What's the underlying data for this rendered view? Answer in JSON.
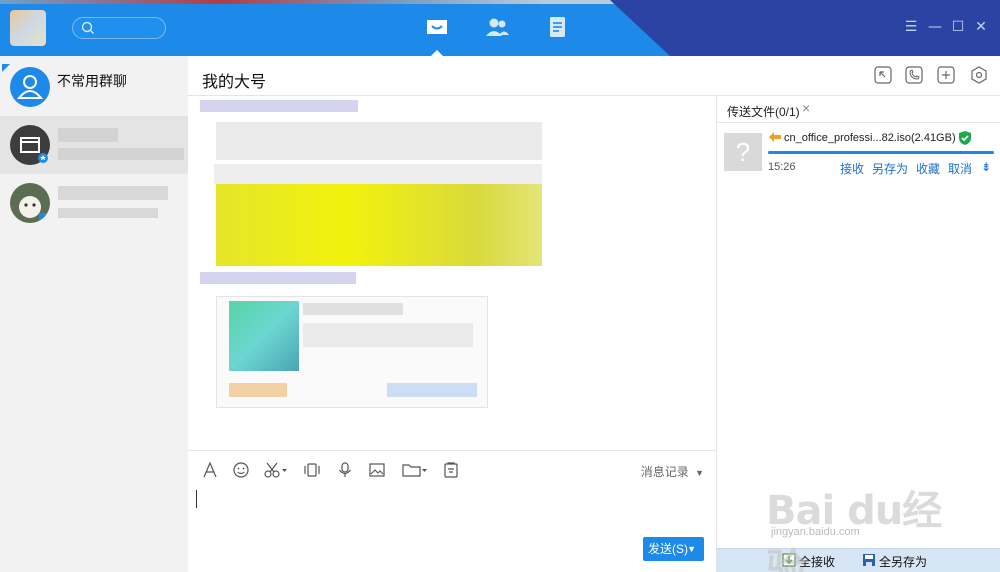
{
  "titlebar": {
    "colors": {
      "primary": "#1d89e8",
      "dark": "#2b44a3"
    },
    "nav": [
      "messages-icon",
      "contacts-icon",
      "apps-icon"
    ],
    "window_controls": {
      "menu": "☰",
      "minimize": "—",
      "maximize": "☐",
      "close": "✕"
    }
  },
  "conversations": {
    "items": [
      {
        "name": "不常用群聊",
        "icon": "group-icon"
      },
      {
        "name": "",
        "icon": "folder-icon"
      },
      {
        "name": "",
        "icon": "cat-avatar"
      }
    ]
  },
  "chat": {
    "title": "我的大号",
    "header_icons": [
      "shrink-icon",
      "phone-icon",
      "add-icon",
      "settings-icon"
    ],
    "toolbar": {
      "tools": [
        "font-icon",
        "emoji-icon",
        "screenshot-icon",
        "shake-icon",
        "voice-icon",
        "image-icon",
        "folder-icon",
        "clipboard-icon"
      ],
      "history_label": "消息记录"
    },
    "send_label": "发送(S)"
  },
  "file_panel": {
    "tab_label": "传送文件(0/1)",
    "file": {
      "name": "cn_office_professi...82.iso(2.41GB)",
      "time": "15:26",
      "progress": 1.0
    },
    "actions": [
      "接收",
      "另存为",
      "收藏",
      "取消"
    ],
    "footer": {
      "receive_all": "全接收",
      "save_all": "全另存为"
    }
  },
  "watermark": {
    "text": "Bai du经验",
    "url": "jingyan.baidu.com"
  }
}
